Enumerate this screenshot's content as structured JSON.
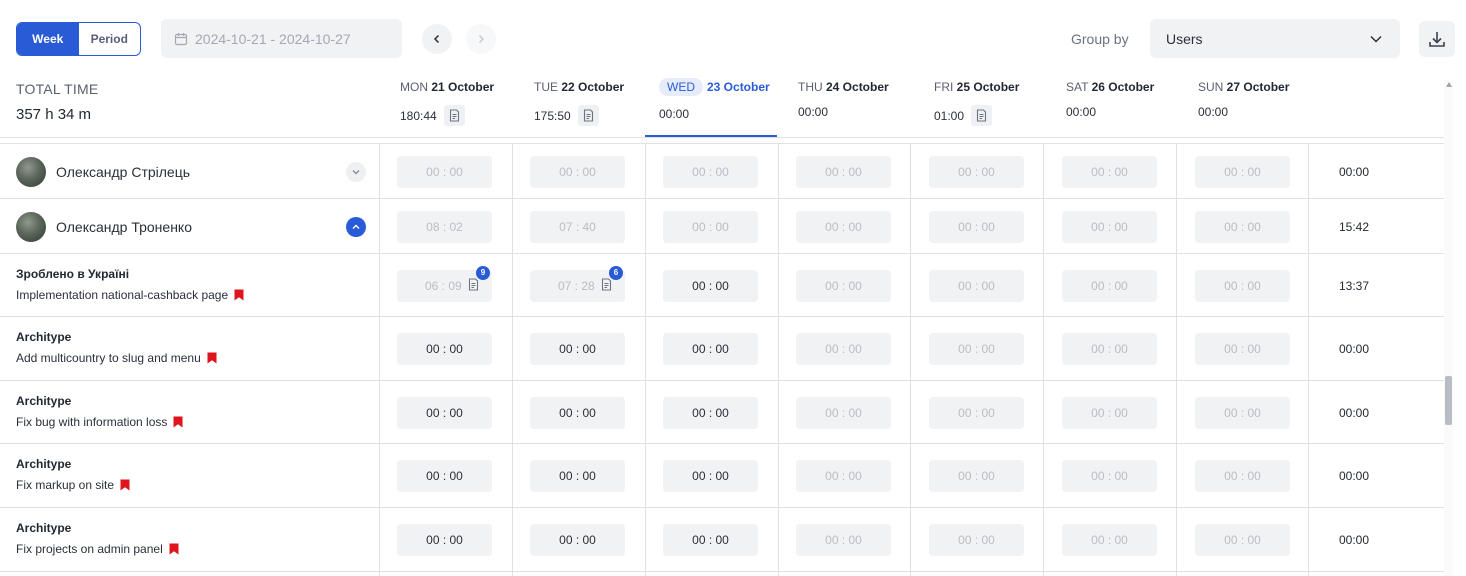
{
  "toolbar": {
    "view_modes": [
      "Week",
      "Period"
    ],
    "active_view": "Week",
    "date_range": "2024-10-21 - 2024-10-27",
    "group_by_label": "Group by",
    "group_by_value": "Users",
    "icons": {
      "calendar": "calendar-icon",
      "prev": "chevron-left-icon",
      "next": "chevron-right-icon",
      "select": "chevron-down-icon",
      "download": "download-icon"
    }
  },
  "header": {
    "total_label": "TOTAL TIME",
    "total_value": "357 h 34 m",
    "days": [
      {
        "dow": "MON",
        "date": "21 October",
        "time": "180:44",
        "has_note": true,
        "today": false
      },
      {
        "dow": "TUE",
        "date": "22 October",
        "time": "175:50",
        "has_note": true,
        "today": false
      },
      {
        "dow": "WED",
        "date": "23 October",
        "time": "00:00",
        "has_note": false,
        "today": true
      },
      {
        "dow": "THU",
        "date": "24 October",
        "time": "00:00",
        "has_note": false,
        "today": false
      },
      {
        "dow": "FRI",
        "date": "25 October",
        "time": "01:00",
        "has_note": true,
        "today": false
      },
      {
        "dow": "SAT",
        "date": "26 October",
        "time": "00:00",
        "has_note": false,
        "today": false
      },
      {
        "dow": "SUN",
        "date": "27 October",
        "time": "00:00",
        "has_note": false,
        "today": false
      }
    ]
  },
  "users": [
    {
      "name": "Олександр Стрілець",
      "expanded": false,
      "times": [
        "00 : 00",
        "00 : 00",
        "00 : 00",
        "00 : 00",
        "00 : 00",
        "00 : 00",
        "00 : 00"
      ],
      "total": "00:00"
    },
    {
      "name": "Олександр Троненко",
      "expanded": true,
      "times": [
        "08 : 02",
        "07 : 40",
        "00 : 00",
        "00 : 00",
        "00 : 00",
        "00 : 00",
        "00 : 00"
      ],
      "total": "15:42"
    }
  ],
  "tasks": [
    {
      "project": "Зроблено в Україні",
      "task": "Implementation national-cashback page",
      "times": [
        "06 : 09",
        "07 : 28",
        "00 : 00",
        "00 : 00",
        "00 : 00",
        "00 : 00",
        "00 : 00"
      ],
      "notes": [
        "9",
        "6",
        null,
        null,
        null,
        null,
        null
      ],
      "active": [
        false,
        false,
        true,
        false,
        false,
        false,
        false
      ],
      "total": "13:37"
    },
    {
      "project": "Architype",
      "task": "Add multicountry to slug and menu",
      "times": [
        "00 : 00",
        "00 : 00",
        "00 : 00",
        "00 : 00",
        "00 : 00",
        "00 : 00",
        "00 : 00"
      ],
      "notes": [
        null,
        null,
        null,
        null,
        null,
        null,
        null
      ],
      "active": [
        true,
        true,
        true,
        false,
        false,
        false,
        false
      ],
      "total": "00:00"
    },
    {
      "project": "Architype",
      "task": "Fix bug with information loss",
      "times": [
        "00 : 00",
        "00 : 00",
        "00 : 00",
        "00 : 00",
        "00 : 00",
        "00 : 00",
        "00 : 00"
      ],
      "notes": [
        null,
        null,
        null,
        null,
        null,
        null,
        null
      ],
      "active": [
        true,
        true,
        true,
        false,
        false,
        false,
        false
      ],
      "total": "00:00"
    },
    {
      "project": "Architype",
      "task": "Fix markup on site",
      "times": [
        "00 : 00",
        "00 : 00",
        "00 : 00",
        "00 : 00",
        "00 : 00",
        "00 : 00",
        "00 : 00"
      ],
      "notes": [
        null,
        null,
        null,
        null,
        null,
        null,
        null
      ],
      "active": [
        true,
        true,
        true,
        false,
        false,
        false,
        false
      ],
      "total": "00:00"
    },
    {
      "project": "Architype",
      "task": "Fix projects on admin panel",
      "times": [
        "00 : 00",
        "00 : 00",
        "00 : 00",
        "00 : 00",
        "00 : 00",
        "00 : 00",
        "00 : 00"
      ],
      "notes": [
        null,
        null,
        null,
        null,
        null,
        null,
        null
      ],
      "active": [
        true,
        true,
        true,
        false,
        false,
        false,
        false
      ],
      "total": "00:00"
    }
  ],
  "colors": {
    "accent": "#2a5bd7",
    "flag": "#e0141e",
    "muted_field": "#f1f2f4"
  }
}
